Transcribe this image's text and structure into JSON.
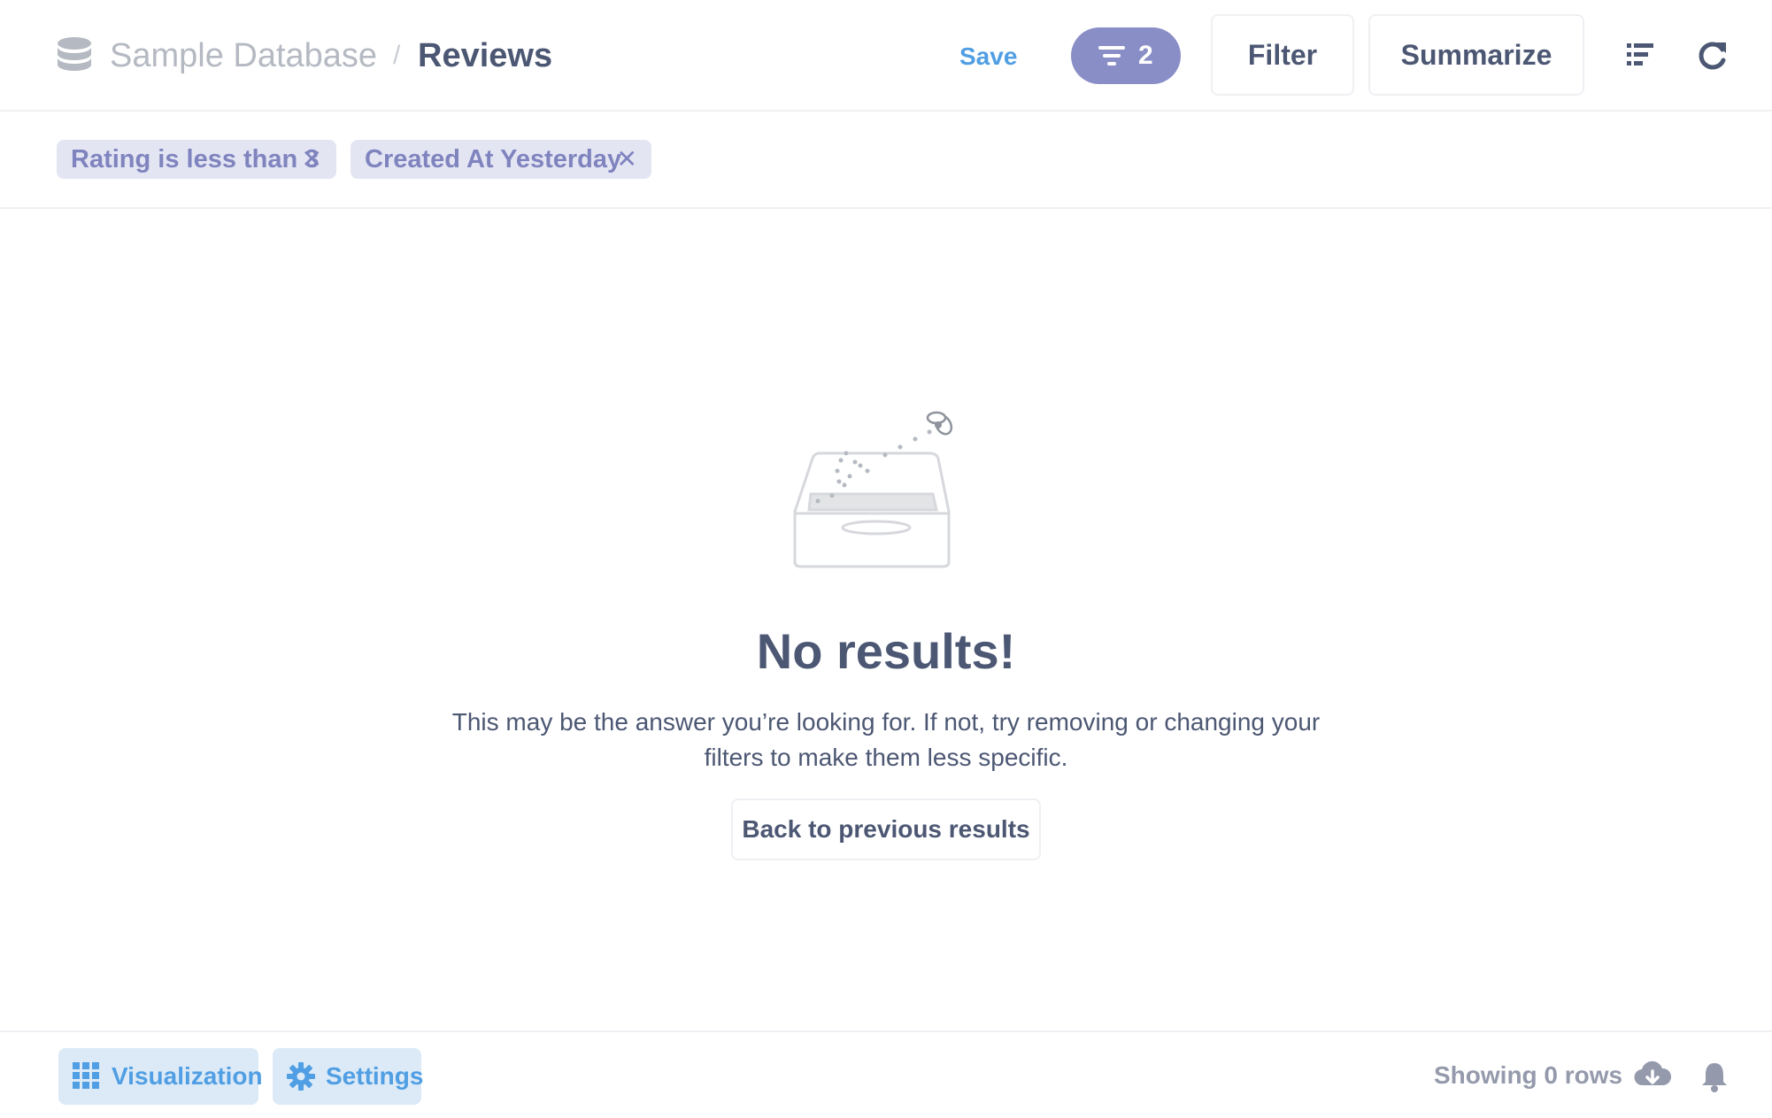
{
  "header": {
    "database_name": "Sample Database",
    "separator": "/",
    "table_name": "Reviews",
    "save_label": "Save",
    "filter_count": "2",
    "filter_label": "Filter",
    "summarize_label": "Summarize"
  },
  "filters": [
    {
      "label": "Rating is less than 3",
      "remove": "✕"
    },
    {
      "label": "Created At Yesterday",
      "remove": "✕"
    }
  ],
  "empty_state": {
    "title": "No results!",
    "message": "This may be the answer you’re looking for. If not, try removing or changing your filters to make them less specific.",
    "back_label": "Back to previous results"
  },
  "footer": {
    "visualization_label": "Visualization",
    "settings_label": "Settings",
    "row_count_text": "Showing 0 rows"
  },
  "colors": {
    "brand": "#509ee3",
    "filter_accent": "#7f84be",
    "text_dark": "#4c5773",
    "text_muted": "#949aab"
  },
  "icons": [
    "database-icon",
    "filter-icon",
    "list-icon",
    "refresh-icon",
    "close-icon",
    "grid-icon",
    "gear-icon",
    "download-icon",
    "bell-icon"
  ]
}
